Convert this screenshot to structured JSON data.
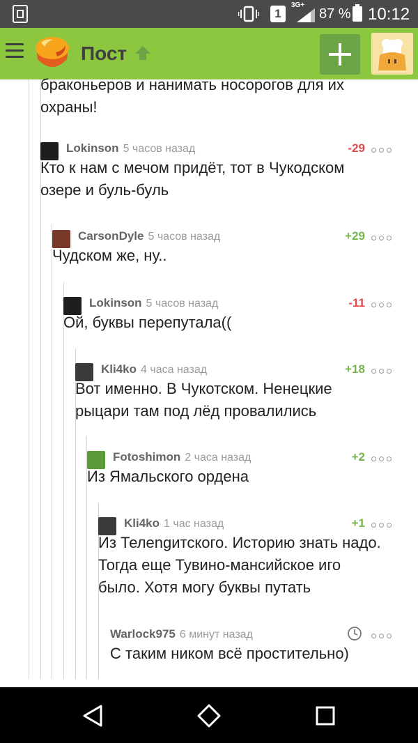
{
  "status_bar": {
    "sim": "1",
    "network": "3G+",
    "battery": "87 %",
    "time": "10:12"
  },
  "header": {
    "title": "Пост"
  },
  "continuation_text": "браконьеров и нанимать носорогов для их охраны!",
  "comments": [
    {
      "author": "Lokinson",
      "time": "5 часов назад",
      "rating": "-29",
      "lines": [
        "Кто к нам с мечом придёт, тот в Чукодском",
        "озере и буль-буль"
      ]
    },
    {
      "author": "CarsonDyle",
      "time": "5 часов назад",
      "rating": "+29",
      "lines": [
        "Чудском же, ну.."
      ]
    },
    {
      "author": "Lokinson",
      "time": "5 часов назад",
      "rating": "-11",
      "lines": [
        "Ой, буквы перепутала(("
      ]
    },
    {
      "author": "Kli4ko",
      "time": "4 часа назад",
      "rating": "+18",
      "lines": [
        "Вот именно. В Чукотском. Ненецкие",
        "рыцари там под лёд провалились"
      ]
    },
    {
      "author": "Fotoshimon",
      "time": "2 часа назад",
      "rating": "+2",
      "lines": [
        "Из Ямальского ордена"
      ]
    },
    {
      "author": "Kli4ko",
      "time": "1 час назад",
      "rating": "+1",
      "lines": [
        "Из Телengитского. Историю знать надо.",
        "Тогда еще Тувино-мансийское иго",
        "было. Хотя могу буквы путать"
      ]
    },
    {
      "author": "Warlock975",
      "time": "6 минут назад",
      "rating": "",
      "lines": [
        "С таким ником всё простительно)"
      ]
    }
  ],
  "colors": {
    "header_bg": "#8dc63f",
    "negative": "#e04b4b",
    "positive": "#76b54b"
  },
  "icons": [
    "menu-icon",
    "logo-icon",
    "arrow-up-icon",
    "plus-icon",
    "clock-icon",
    "more-icon",
    "back-icon",
    "home-icon",
    "recents-icon"
  ]
}
